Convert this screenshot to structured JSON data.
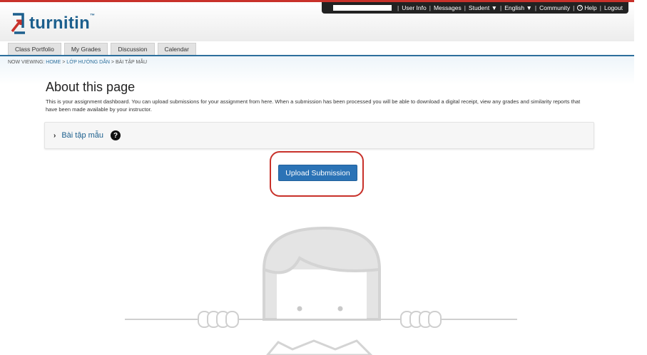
{
  "topbar": {
    "items": [
      "User Info",
      "Messages",
      "Student ▼",
      "English ▼",
      "Community",
      "Help",
      "Logout"
    ]
  },
  "brand": {
    "name": "turnitin",
    "tm": "™",
    "color": "#1c5f8d",
    "accent": "#c8312a"
  },
  "tabs": [
    "Class Portfolio",
    "My Grades",
    "Discussion",
    "Calendar"
  ],
  "breadcrumb": {
    "prefix": "NOW VIEWING:",
    "home": "HOME",
    "sep": ">",
    "class": "LỚP HƯỚNG DẪN",
    "current": "BÀI TẬP MẪU"
  },
  "main": {
    "title": "About this page",
    "description": "This is your assignment dashboard. You can upload submissions for your assignment from here. When a submission has been processed you will be able to download a digital receipt, view any grades and similarity reports that have been made available by your instructor.",
    "assignment_title": "Bài tập mẫu",
    "upload_label": "Upload Submission"
  }
}
